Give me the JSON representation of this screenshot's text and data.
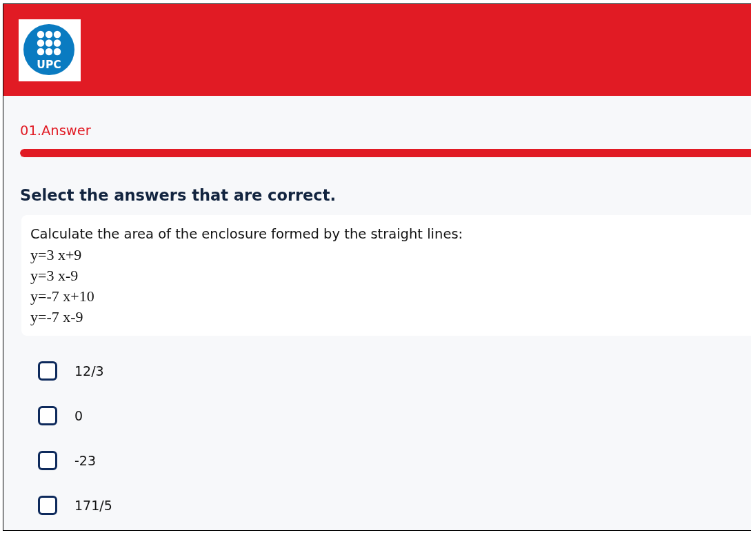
{
  "header": {
    "logo_text": "UPC"
  },
  "section": {
    "title": "01.Answer",
    "progress": {
      "level": 1
    }
  },
  "question": {
    "instruction": "Select the answers that are correct.",
    "prompt": "Calculate the area of the enclosure formed by the straight lines:",
    "equations": [
      "y=3 x+9",
      "y=3 x-9",
      "y=-7 x+10",
      "y=-7 x-9"
    ]
  },
  "options": [
    {
      "label": "12/3",
      "checked": false
    },
    {
      "label": "0",
      "checked": false
    },
    {
      "label": "-23",
      "checked": false
    },
    {
      "label": "171/5",
      "checked": false
    }
  ]
}
